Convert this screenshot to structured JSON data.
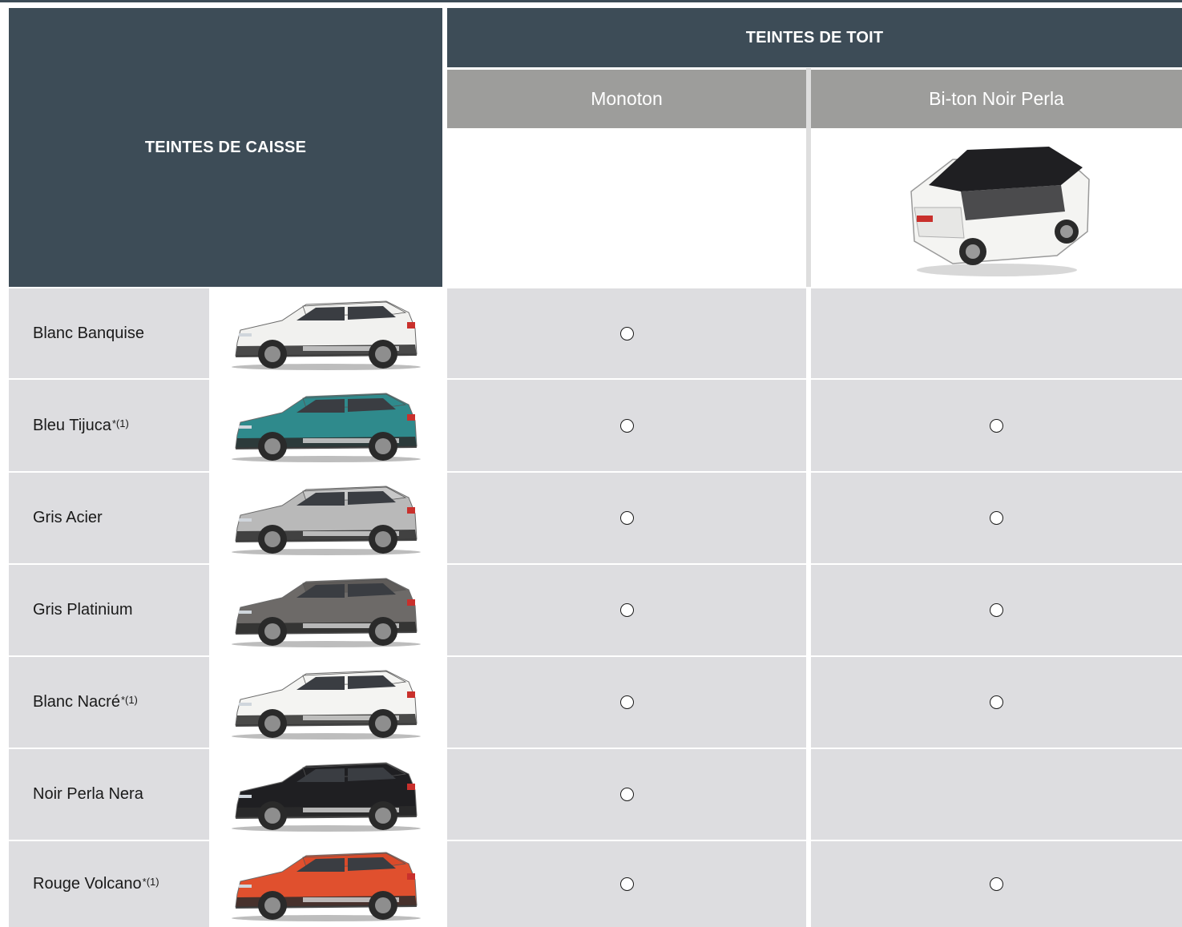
{
  "header": {
    "body_colors_label": "TEINTES DE CAISSE",
    "roof_colors_label": "TEINTES DE TOIT",
    "roof_options": [
      "Monoton",
      "Bi-ton Noir Perla"
    ]
  },
  "rows": [
    {
      "name": "Blanc Banquise",
      "note": "",
      "body_color": "#f1f1ef",
      "roof_color": "#f1f1ef",
      "monoton": true,
      "biton": false
    },
    {
      "name": "Bleu Tijuca",
      "note": "*(1)",
      "body_color": "#2f8a8c",
      "roof_color": "#2f8a8c",
      "monoton": true,
      "biton": true
    },
    {
      "name": "Gris Acier",
      "note": "",
      "body_color": "#b9b9b9",
      "roof_color": "#c8c8c8",
      "monoton": true,
      "biton": true
    },
    {
      "name": "Gris Platinium",
      "note": "",
      "body_color": "#6d6a68",
      "roof_color": "#5f5c5a",
      "monoton": true,
      "biton": true
    },
    {
      "name": "Blanc Nacré",
      "note": "*(1)",
      "body_color": "#f4f4f2",
      "roof_color": "#f4f4f2",
      "monoton": true,
      "biton": true
    },
    {
      "name": "Noir Perla Nera",
      "note": "",
      "body_color": "#1f1f22",
      "roof_color": "#1f1f22",
      "monoton": true,
      "biton": false
    },
    {
      "name": "Rouge Volcano",
      "note": "*(1)",
      "body_color": "#e0502e",
      "roof_color": "#d94a2a",
      "monoton": true,
      "biton": true
    }
  ],
  "colors": {
    "header_dark": "#3d4c57",
    "header_sub": "#9d9d9b",
    "row_bg": "#dddde0"
  },
  "icons": {
    "availability": "circle-outline-icon",
    "car": "car-side-view-icon",
    "car_top": "car-top-view-icon"
  }
}
